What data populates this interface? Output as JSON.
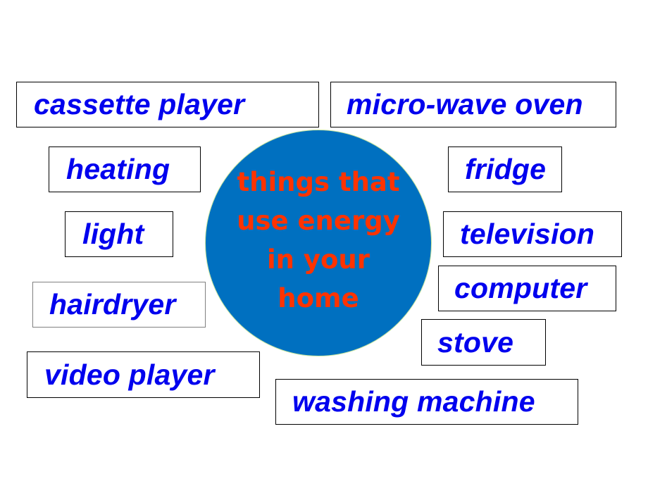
{
  "center": {
    "lines": [
      "things that",
      "use energy",
      "in your",
      "home"
    ],
    "fill_color": "#0070c0",
    "text_color": "#ff3300"
  },
  "items": [
    {
      "id": "cassette-player",
      "label": "cassette player"
    },
    {
      "id": "micro-wave-oven",
      "label": "micro-wave oven"
    },
    {
      "id": "heating",
      "label": "heating"
    },
    {
      "id": "fridge",
      "label": "fridge"
    },
    {
      "id": "light",
      "label": "light"
    },
    {
      "id": "television",
      "label": "television"
    },
    {
      "id": "computer",
      "label": "computer"
    },
    {
      "id": "hairdryer",
      "label": "hairdryer"
    },
    {
      "id": "stove",
      "label": "stove"
    },
    {
      "id": "video-player",
      "label": "video player"
    },
    {
      "id": "washing-machine",
      "label": "washing machine"
    }
  ],
  "label_color": "#0000ee"
}
